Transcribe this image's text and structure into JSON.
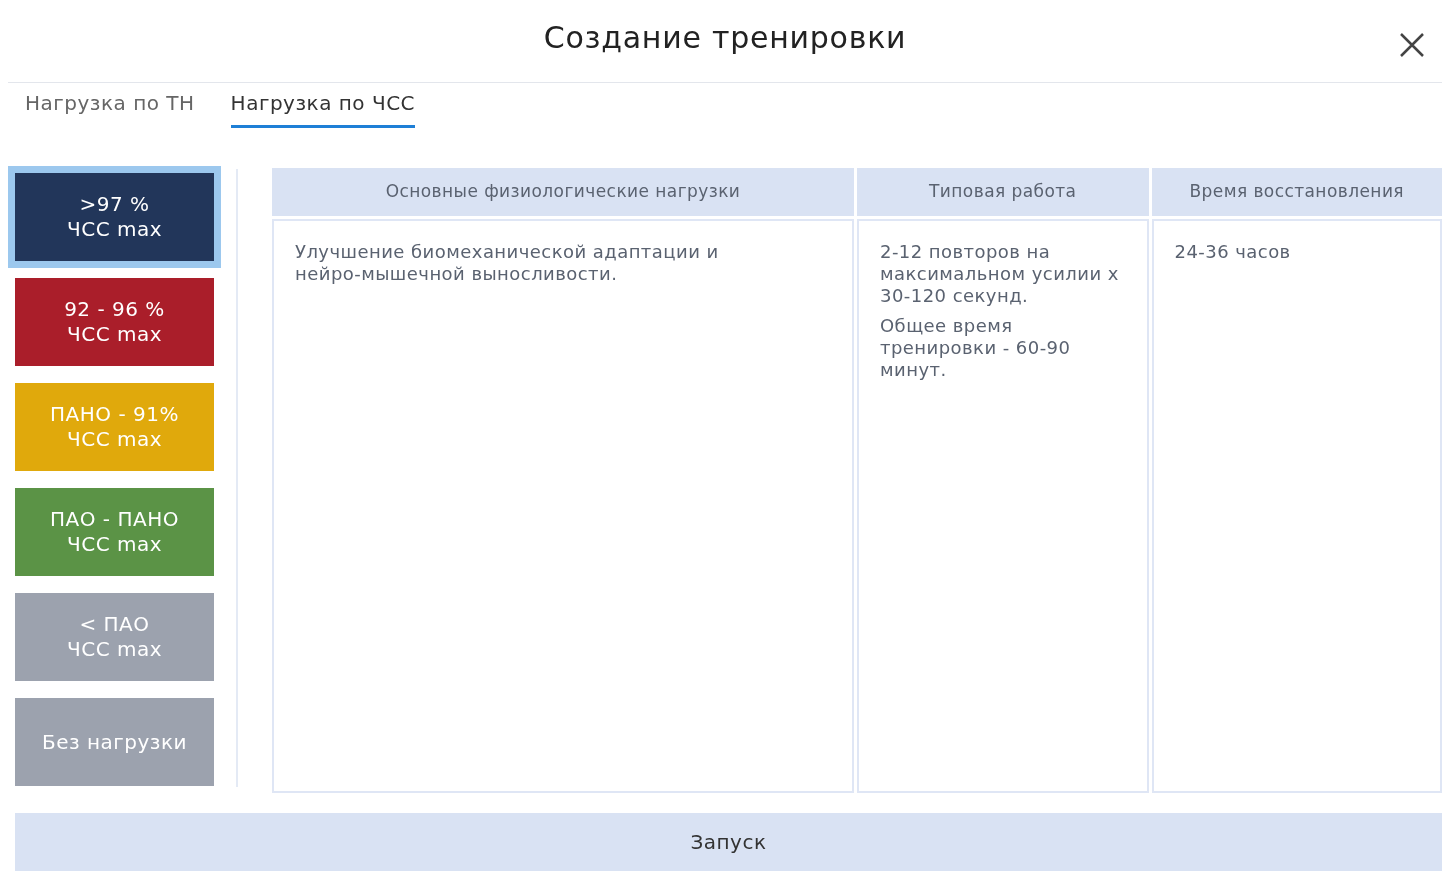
{
  "dialog": {
    "title": "Создание тренировки"
  },
  "tabs": [
    {
      "label": "Нагрузка по ТН",
      "selected": false
    },
    {
      "label": "Нагрузка по ЧСС",
      "selected": true
    }
  ],
  "zones": [
    {
      "label": ">97 %\nЧСС max",
      "color": "#22365a",
      "selected": true
    },
    {
      "label": "92 - 96 %\nЧСС max",
      "color": "#aa1e2a",
      "selected": false
    },
    {
      "label": "ПАНО - 91%\nЧСС max",
      "color": "#e0a90c",
      "selected": false
    },
    {
      "label": "ПАО - ПАНО\nЧСС max",
      "color": "#5b9346",
      "selected": false
    },
    {
      "label": "< ПАО\nЧСС max",
      "color": "#9ca2ae",
      "selected": false
    },
    {
      "label": "Без нагрузки",
      "color": "#9ca2ae",
      "selected": false
    }
  ],
  "table": {
    "columns": [
      "Основные физиологические нагрузки",
      "Типовая работа",
      "Время восстановления"
    ],
    "rows": [
      [
        [
          "Улучшение биомеханической адаптации и нейро-мышечной выносливости."
        ],
        [
          "2-12 повторов на максимальном усилии х 30-120 секунд.",
          "Общее время тренировки - 60-90 минут."
        ],
        [
          "24-36 часов"
        ]
      ]
    ]
  },
  "launch_button": "Запуск"
}
